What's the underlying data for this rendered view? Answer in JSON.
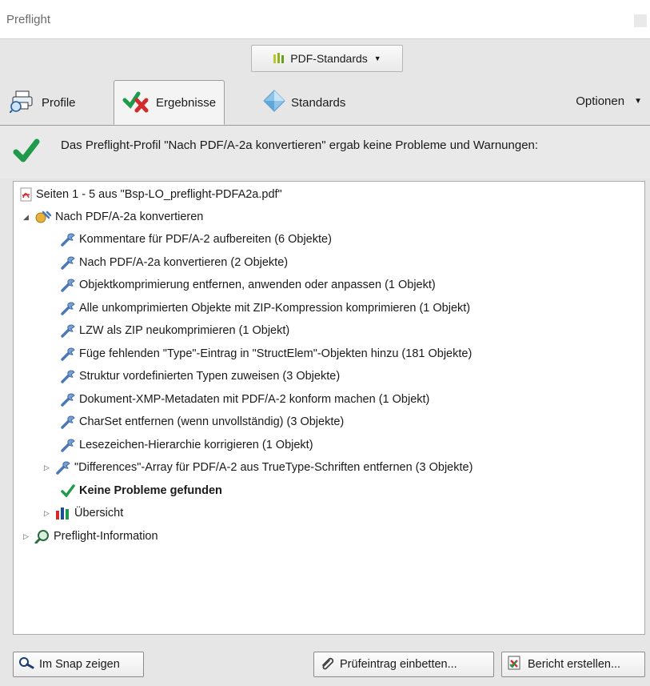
{
  "window": {
    "title": "Preflight"
  },
  "toolbar": {
    "standards_dropdown": "PDF-Standards"
  },
  "tabs": {
    "profile": "Profile",
    "results": "Ergebnisse",
    "standards": "Standards",
    "options": "Optionen"
  },
  "summary": {
    "message": "Das Preflight-Profil \"Nach PDF/A-2a konvertieren\" ergab keine Probleme und Warnungen:"
  },
  "tree": {
    "root": "Seiten 1 - 5 aus \"Bsp-LO_preflight-PDFA2a.pdf\"",
    "profile_node": "Nach PDF/A-2a konvertieren",
    "fixups": [
      "Kommentare für PDF/A-2 aufbereiten (6 Objekte)",
      "Nach PDF/A-2a konvertieren (2 Objekte)",
      "Objektkomprimierung entfernen, anwenden oder anpassen (1 Objekt)",
      "Alle unkomprimierten Objekte mit ZIP-Kompression komprimieren (1 Objekt)",
      "LZW als ZIP neukomprimieren (1 Objekt)",
      "Füge fehlenden \"Type\"-Eintrag in \"StructElem\"-Objekten hinzu (181 Objekte)",
      "Struktur vordefinierten Typen zuweisen (3 Objekte)",
      "Dokument-XMP-Metadaten mit PDF/A-2 konform machen (1 Objekt)",
      "CharSet entfernen (wenn unvollständig) (3 Objekte)",
      "Lesezeichen-Hierarchie korrigieren (1 Objekt)",
      "\"Differences\"-Array für PDF/A-2 aus TrueType-Schriften entfernen (3 Objekte)"
    ],
    "no_problems": "Keine Probleme gefunden",
    "overview": "Übersicht",
    "preflight_info": "Preflight-Information"
  },
  "buttons": {
    "snap": "Im Snap zeigen",
    "embed": "Prüfeintrag einbetten...",
    "report": "Bericht erstellen..."
  },
  "colors": {
    "check_green": "#1e9a4a",
    "pdf_red": "#d22b2b",
    "wrench_blue": "#4b79b8"
  }
}
